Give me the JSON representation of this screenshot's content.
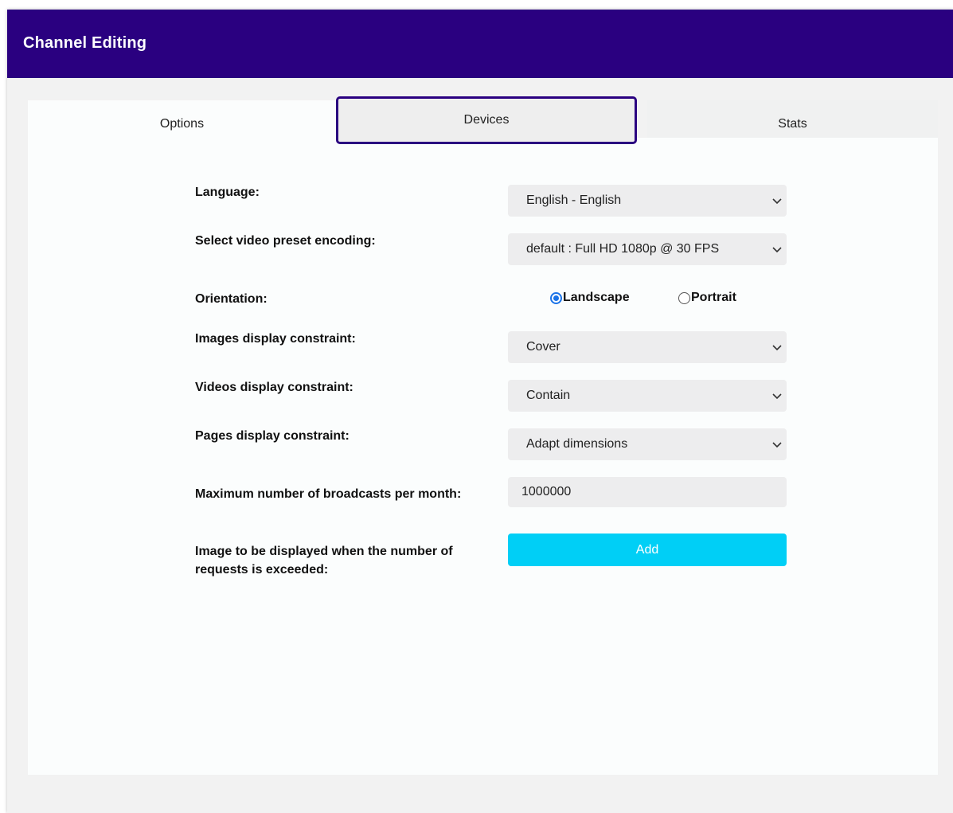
{
  "header": {
    "title": "Channel Editing"
  },
  "tabs": [
    {
      "label": "Options"
    },
    {
      "label": "Devices"
    },
    {
      "label": "Stats"
    }
  ],
  "active_tab": "Devices",
  "form": {
    "language": {
      "label": "Language:",
      "value": "English - English"
    },
    "preset": {
      "label": "Select video preset encoding:",
      "value": "default : Full HD 1080p @ 30 FPS"
    },
    "orientation": {
      "label": "Orientation:",
      "options": [
        "Landscape",
        "Portrait"
      ],
      "selected": "Landscape"
    },
    "images_constraint": {
      "label": "Images display constraint:",
      "value": "Cover"
    },
    "videos_constraint": {
      "label": "Videos display constraint:",
      "value": "Contain"
    },
    "pages_constraint": {
      "label": "Pages display constraint:",
      "value": "Adapt dimensions"
    },
    "max_broadcasts": {
      "label": "Maximum number of broadcasts per month:",
      "value": "1000000"
    },
    "exceeded_image": {
      "label_line1": "Image to be displayed when the number of",
      "label_line2": "requests is exceeded:",
      "button_label": "Add"
    }
  },
  "icons": {
    "select_arrow": "chevron-down-icon"
  },
  "colors": {
    "header_bg": "#2a0080",
    "active_tab_border": "#2a0080",
    "add_button": "#00cff6",
    "radio_checked": "#1a73e8"
  }
}
